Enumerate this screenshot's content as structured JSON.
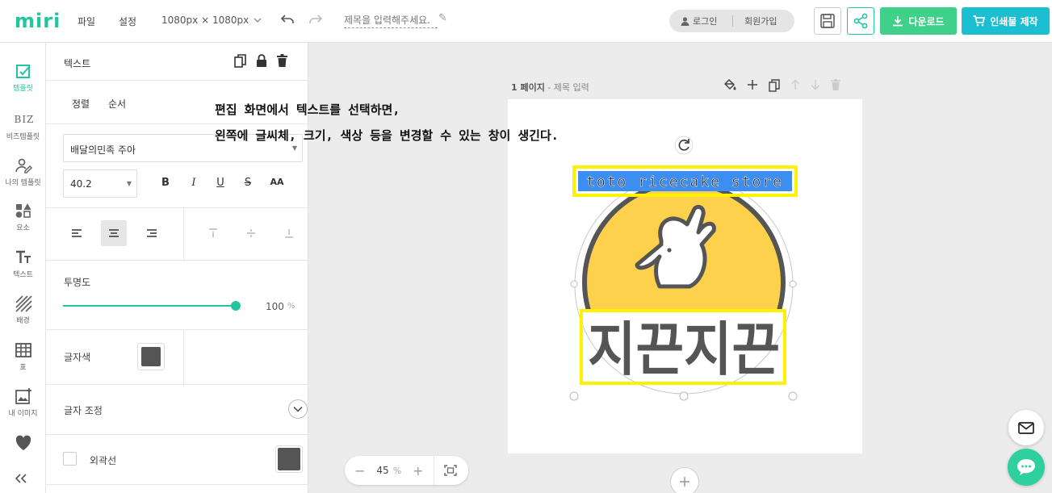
{
  "topbar": {
    "logo": "miri",
    "menu_file": "파일",
    "menu_settings": "설정",
    "canvas_size": "1080px × 1080px",
    "title_placeholder": "제목을 입력해주세요.",
    "login": "로그인",
    "signup": "회원가입",
    "download": "다운로드",
    "print": "인쇄물 제작"
  },
  "leftnav": {
    "items": [
      {
        "label": "템플릿",
        "icon": "template-icon"
      },
      {
        "label": "비즈템플릿",
        "icon": "biz-icon",
        "icon_text": "BIZ"
      },
      {
        "label": "나의 템플릿",
        "icon": "my-template-icon"
      },
      {
        "label": "요소",
        "icon": "elements-icon"
      },
      {
        "label": "텍스트",
        "icon": "text-icon"
      },
      {
        "label": "배경",
        "icon": "background-icon"
      },
      {
        "label": "표",
        "icon": "table-icon"
      },
      {
        "label": "내 이미지",
        "icon": "my-image-icon"
      }
    ]
  },
  "panel": {
    "title": "텍스트",
    "tab_align": "정렬",
    "tab_order": "순서",
    "font_family": "배달의민족 주아",
    "font_size": "40.2",
    "format": {
      "bold": "B",
      "italic": "I",
      "underline": "U",
      "strike": "S",
      "case": "AA"
    },
    "opacity_label": "투명도",
    "opacity_value": "100",
    "opacity_unit": "%",
    "opacity_level": 1.0,
    "text_color_label": "글자색",
    "adjust_label": "글자 조정",
    "outline_label": "외곽선",
    "text_color": "#555555"
  },
  "canvas": {
    "page_label": "1 페이지",
    "page_sub": " - 제목 입력",
    "logo_en": "toto ricecake store",
    "logo_kr": "지끈지끈",
    "circle_color": "#fdd14b",
    "outline_color": "#555555",
    "selection_color": "#3d8ef0",
    "highlight_color": "#fff200"
  },
  "annotation": {
    "line1": "편집 화면에서 텍스트를 선택하면,",
    "line2": "왼쪽에 글씨체, 크기, 색상 등을 변경할 수 있는 창이 생긴다."
  },
  "zoom": {
    "value": "45",
    "unit": "%"
  }
}
